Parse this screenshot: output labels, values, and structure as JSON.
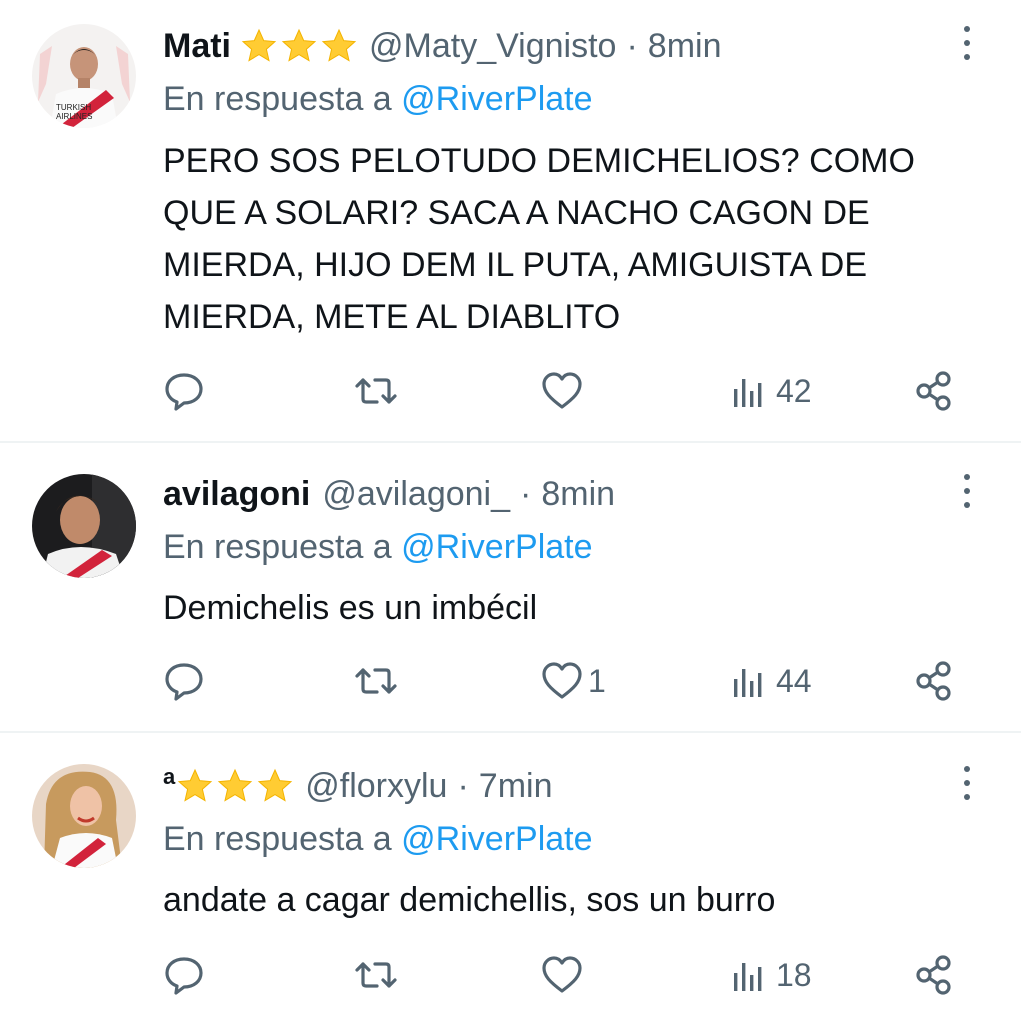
{
  "tweets": [
    {
      "name": "Mati",
      "stars": 3,
      "handle": "@Maty_Vignisto",
      "separator": "·",
      "time": "8min",
      "reply_prefix": "En respuesta a",
      "reply_to": "@RiverPlate",
      "text": "PERO SOS PELOTUDO DEMICHELIOS? COMO QUE A SOLARI? SACA A NACHO CAGON DE MIERDA, HIJO DEM IL PUTA, AMIGUISTA DE MIERDA, METE AL DIABLITO",
      "likes": "",
      "views": "42"
    },
    {
      "name": "avilagoni",
      "stars": 0,
      "handle": "@avilagoni_",
      "separator": "·",
      "time": "8min",
      "reply_prefix": "En respuesta a",
      "reply_to": "@RiverPlate",
      "text": "Demichelis es un imbécil",
      "likes": "1",
      "views": "44"
    },
    {
      "name": "a",
      "stars": 3,
      "handle": "@florxylu",
      "separator": "·",
      "time": "7min",
      "reply_prefix": "En respuesta a",
      "reply_to": "@RiverPlate",
      "text": "andate a cagar demichellis, sos un burro",
      "likes": "",
      "views": "18"
    }
  ],
  "icons": {
    "reply": "reply-icon",
    "retweet": "retweet-icon",
    "like": "heart-icon",
    "views": "views-icon",
    "share": "share-icon",
    "more": "more-icon",
    "star": "star-icon"
  },
  "colors": {
    "text": "#0f1419",
    "secondary": "#536471",
    "mention": "#1d9bf0",
    "star": "#ffcc33",
    "divider": "#eff3f4"
  }
}
